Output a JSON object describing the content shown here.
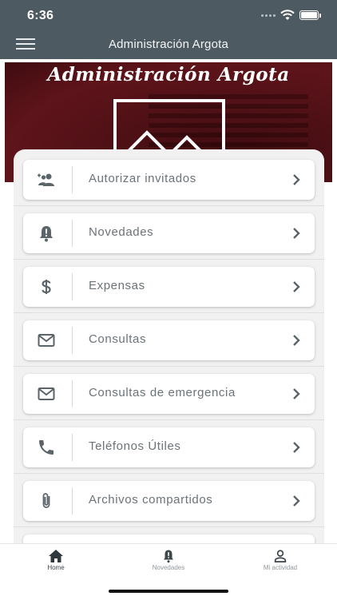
{
  "status_bar": {
    "time": "6:36"
  },
  "nav_bar": {
    "title": "Administración Argota",
    "menu_icon": "hamburger-menu-icon"
  },
  "banner": {
    "title": "Administración Argota"
  },
  "menu_items": [
    {
      "label": "Autorizar invitados",
      "icon": "add-guests-icon"
    },
    {
      "label": "Novedades",
      "icon": "bell-alert-icon"
    },
    {
      "label": "Expensas",
      "icon": "dollar-icon"
    },
    {
      "label": "Consultas",
      "icon": "envelope-icon"
    },
    {
      "label": "Consultas de emergencia",
      "icon": "envelope-icon"
    },
    {
      "label": "Teléfonos Útiles",
      "icon": "phone-icon"
    },
    {
      "label": "Archivos compartidos",
      "icon": "paperclip-icon"
    }
  ],
  "tab_bar": {
    "tabs": [
      {
        "label": "Home",
        "icon": "home-icon",
        "active": true
      },
      {
        "label": "Novedades",
        "icon": "bell-alert-icon",
        "active": false
      },
      {
        "label": "Mi actividad",
        "icon": "user-icon",
        "active": false
      }
    ]
  },
  "colors": {
    "header": "#4e5a61",
    "banner": "#5e141a",
    "list_bg": "#f1f1f2",
    "card_text": "#6b7378",
    "icon": "#5a6469"
  }
}
